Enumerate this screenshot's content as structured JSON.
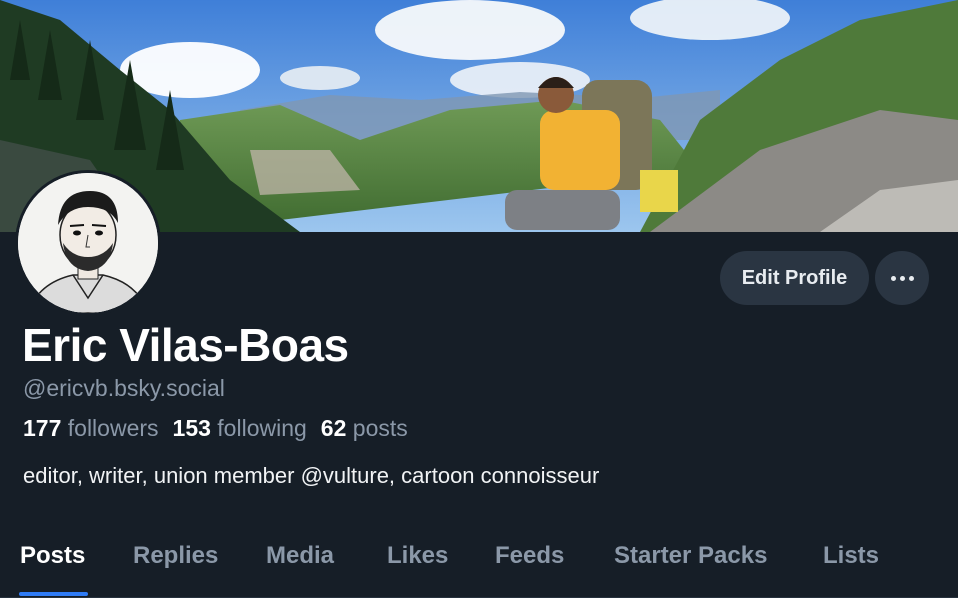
{
  "profile": {
    "display_name": "Eric Vilas-Boas",
    "handle": "@ericvb.bsky.social",
    "bio": "editor, writer, union member @vulture, cartoon connoisseur"
  },
  "stats": {
    "followers_count": "177",
    "followers_label": "followers",
    "following_count": "153",
    "following_label": "following",
    "posts_count": "62",
    "posts_label": "posts"
  },
  "actions": {
    "edit_profile_label": "Edit Profile",
    "more_icon": "ellipsis-icon"
  },
  "tabs": [
    {
      "label": "Posts",
      "active": true
    },
    {
      "label": "Replies",
      "active": false
    },
    {
      "label": "Media",
      "active": false
    },
    {
      "label": "Likes",
      "active": false
    },
    {
      "label": "Feeds",
      "active": false
    },
    {
      "label": "Starter Packs",
      "active": false
    },
    {
      "label": "Lists",
      "active": false
    }
  ],
  "colors": {
    "background": "#161e27",
    "accent": "#2f7cf6",
    "button_bg": "#2a3542",
    "muted_text": "#8b98a8"
  }
}
